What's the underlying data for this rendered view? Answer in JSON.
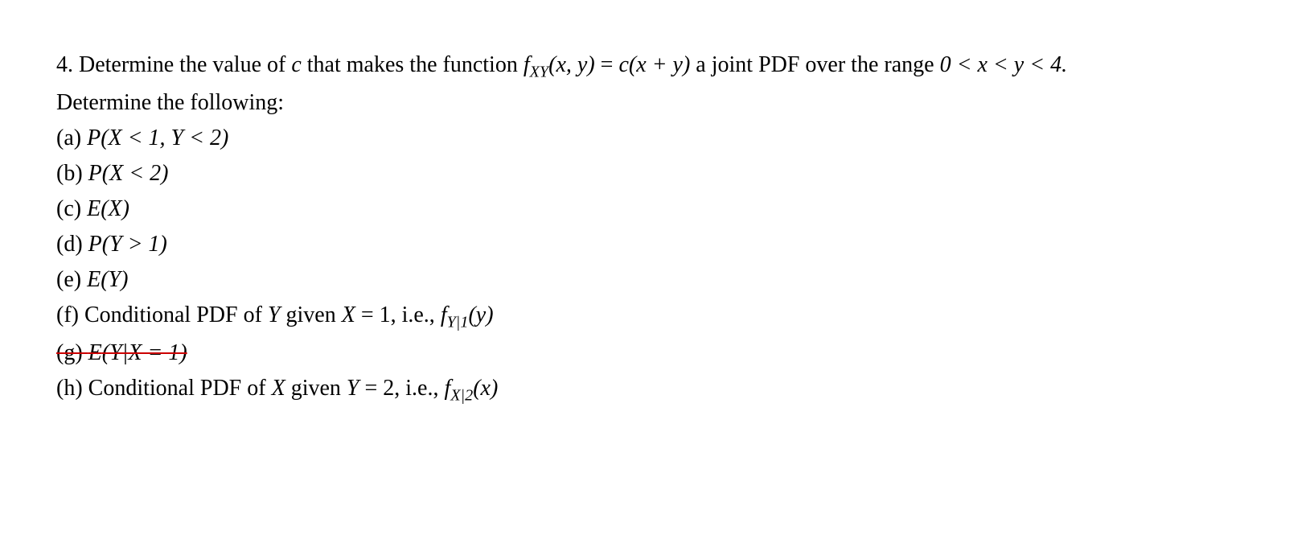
{
  "problem": {
    "number": "4.",
    "intro_part1": "Determine the value of ",
    "intro_c": "c",
    "intro_part2": " that makes the function ",
    "func_f": "f",
    "func_sub": "XY",
    "func_args": "(x, y)",
    "equals": " = ",
    "rhs_c": "c",
    "rhs_rest": "(x + y)",
    "intro_part3": " a joint PDF over the range ",
    "range": "0 < x < y < 4.",
    "determine": "Determine the following:",
    "items": {
      "a": {
        "label": "(a) ",
        "P": "P",
        "content": "(X < 1, Y < 2)"
      },
      "b": {
        "label": "(b) ",
        "P": "P",
        "content": "(X < 2)"
      },
      "c": {
        "label": "(c) ",
        "E": "E",
        "content": "(X)"
      },
      "d": {
        "label": "(d) ",
        "P": "P",
        "content": "(Y > 1)"
      },
      "e": {
        "label": "(e) ",
        "E": "E",
        "content": "(Y)"
      },
      "f": {
        "label": "(f) ",
        "text1": "Conditional PDF of ",
        "Y": "Y",
        "text2": " given ",
        "X": "X",
        "eq": " = 1, i.e., ",
        "func_f": "f",
        "func_sub": "Y|1",
        "func_arg": "(y)"
      },
      "g": {
        "label": "(g) ",
        "E": "E",
        "content": "(Y|X = 1)"
      },
      "h": {
        "label": "(h) ",
        "text1": "Conditional PDF of ",
        "X": "X",
        "text2": " given ",
        "Y": "Y",
        "eq": " = 2, i.e., ",
        "func_f": "f",
        "func_sub": "X|2",
        "func_arg": "(x)"
      }
    }
  }
}
